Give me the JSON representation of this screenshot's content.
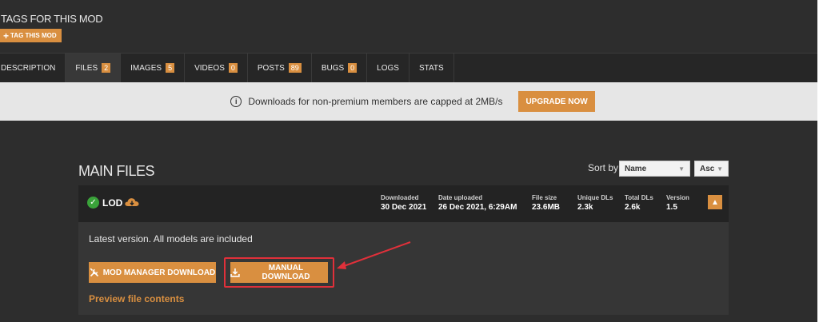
{
  "tags": {
    "title": "TAGS FOR THIS MOD",
    "tag_button": "TAG THIS MOD"
  },
  "tabs": [
    {
      "label": "DESCRIPTION",
      "badge": ""
    },
    {
      "label": "FILES",
      "badge": "2"
    },
    {
      "label": "IMAGES",
      "badge": "5"
    },
    {
      "label": "VIDEOS",
      "badge": "0"
    },
    {
      "label": "POSTS",
      "badge": "89"
    },
    {
      "label": "BUGS",
      "badge": "0"
    },
    {
      "label": "LOGS",
      "badge": ""
    },
    {
      "label": "STATS",
      "badge": ""
    }
  ],
  "banner": {
    "text": "Downloads for non-premium members are capped at 2MB/s",
    "upgrade": "UPGRADE NOW",
    "info_icon": "i"
  },
  "main": {
    "title": "MAIN FILES",
    "sort_label": "Sort by",
    "sort_field": "Name",
    "sort_order": "Asc"
  },
  "file": {
    "name": "LOD",
    "stats": [
      {
        "label": "Downloaded",
        "value": "30 Dec 2021"
      },
      {
        "label": "Date uploaded",
        "value": "26 Dec 2021, 6:29AM"
      },
      {
        "label": "File size",
        "value": "23.6MB"
      },
      {
        "label": "Unique DLs",
        "value": "2.3k"
      },
      {
        "label": "Total DLs",
        "value": "2.6k"
      },
      {
        "label": "Version",
        "value": "1.5"
      }
    ],
    "description": "Latest version. All models are included",
    "mod_manager_button": "MOD MANAGER DOWNLOAD",
    "manual_button": "MANUAL DOWNLOAD",
    "preview_link": "Preview file contents"
  },
  "colors": {
    "accent": "#d98f40",
    "highlight": "#e0303a",
    "success": "#3aa33a"
  }
}
